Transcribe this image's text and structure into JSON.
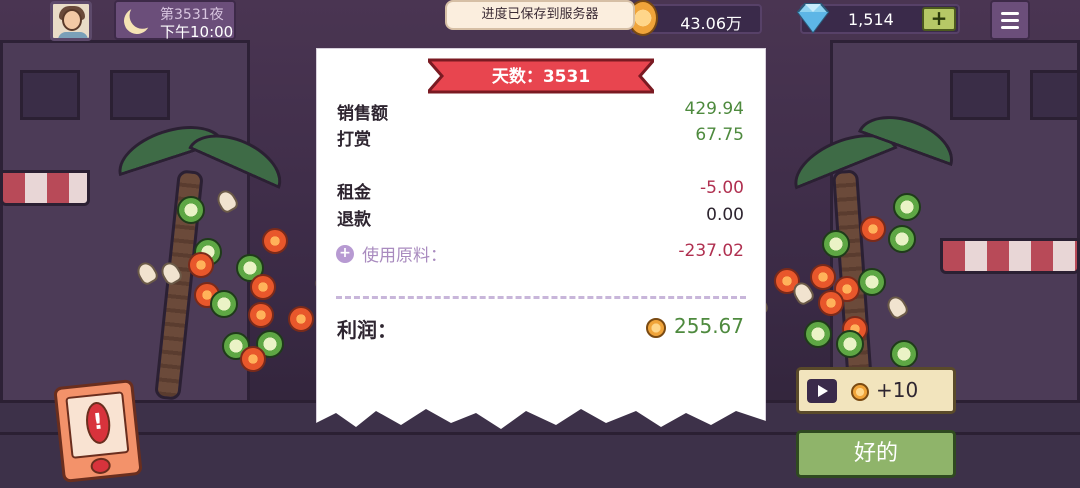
{
  "hud": {
    "night_label": "第3531夜",
    "time_label": "下午10:00",
    "save_toast": "进度已保存到服务器",
    "coins": "43.06万",
    "gems": "1,514",
    "gem_add": "+"
  },
  "receipt": {
    "day_title": "天数：3531",
    "rows": [
      {
        "label": "销售额",
        "value": "429.94"
      },
      {
        "label": "打赏",
        "value": "67.75"
      },
      {
        "label": "租金",
        "value": "-5.00"
      },
      {
        "label": "退款",
        "value": "0.00"
      }
    ],
    "materials": {
      "label": "使用原料：",
      "value": "-237.02",
      "expand": "+"
    },
    "profit": {
      "label": "利润：",
      "value": "255.67"
    }
  },
  "actions": {
    "ad_reward": "+10",
    "ok": "好的",
    "alert": "!"
  },
  "colors": {
    "positive": "#4e8a3e",
    "negative": "#b03050",
    "ribbon": "#e8454f",
    "ok_button": "#8fb46a"
  },
  "icons": [
    "avatar",
    "moon-icon",
    "coin-icon",
    "diamond-icon",
    "menu-icon",
    "play-video-icon",
    "alert-icon"
  ]
}
